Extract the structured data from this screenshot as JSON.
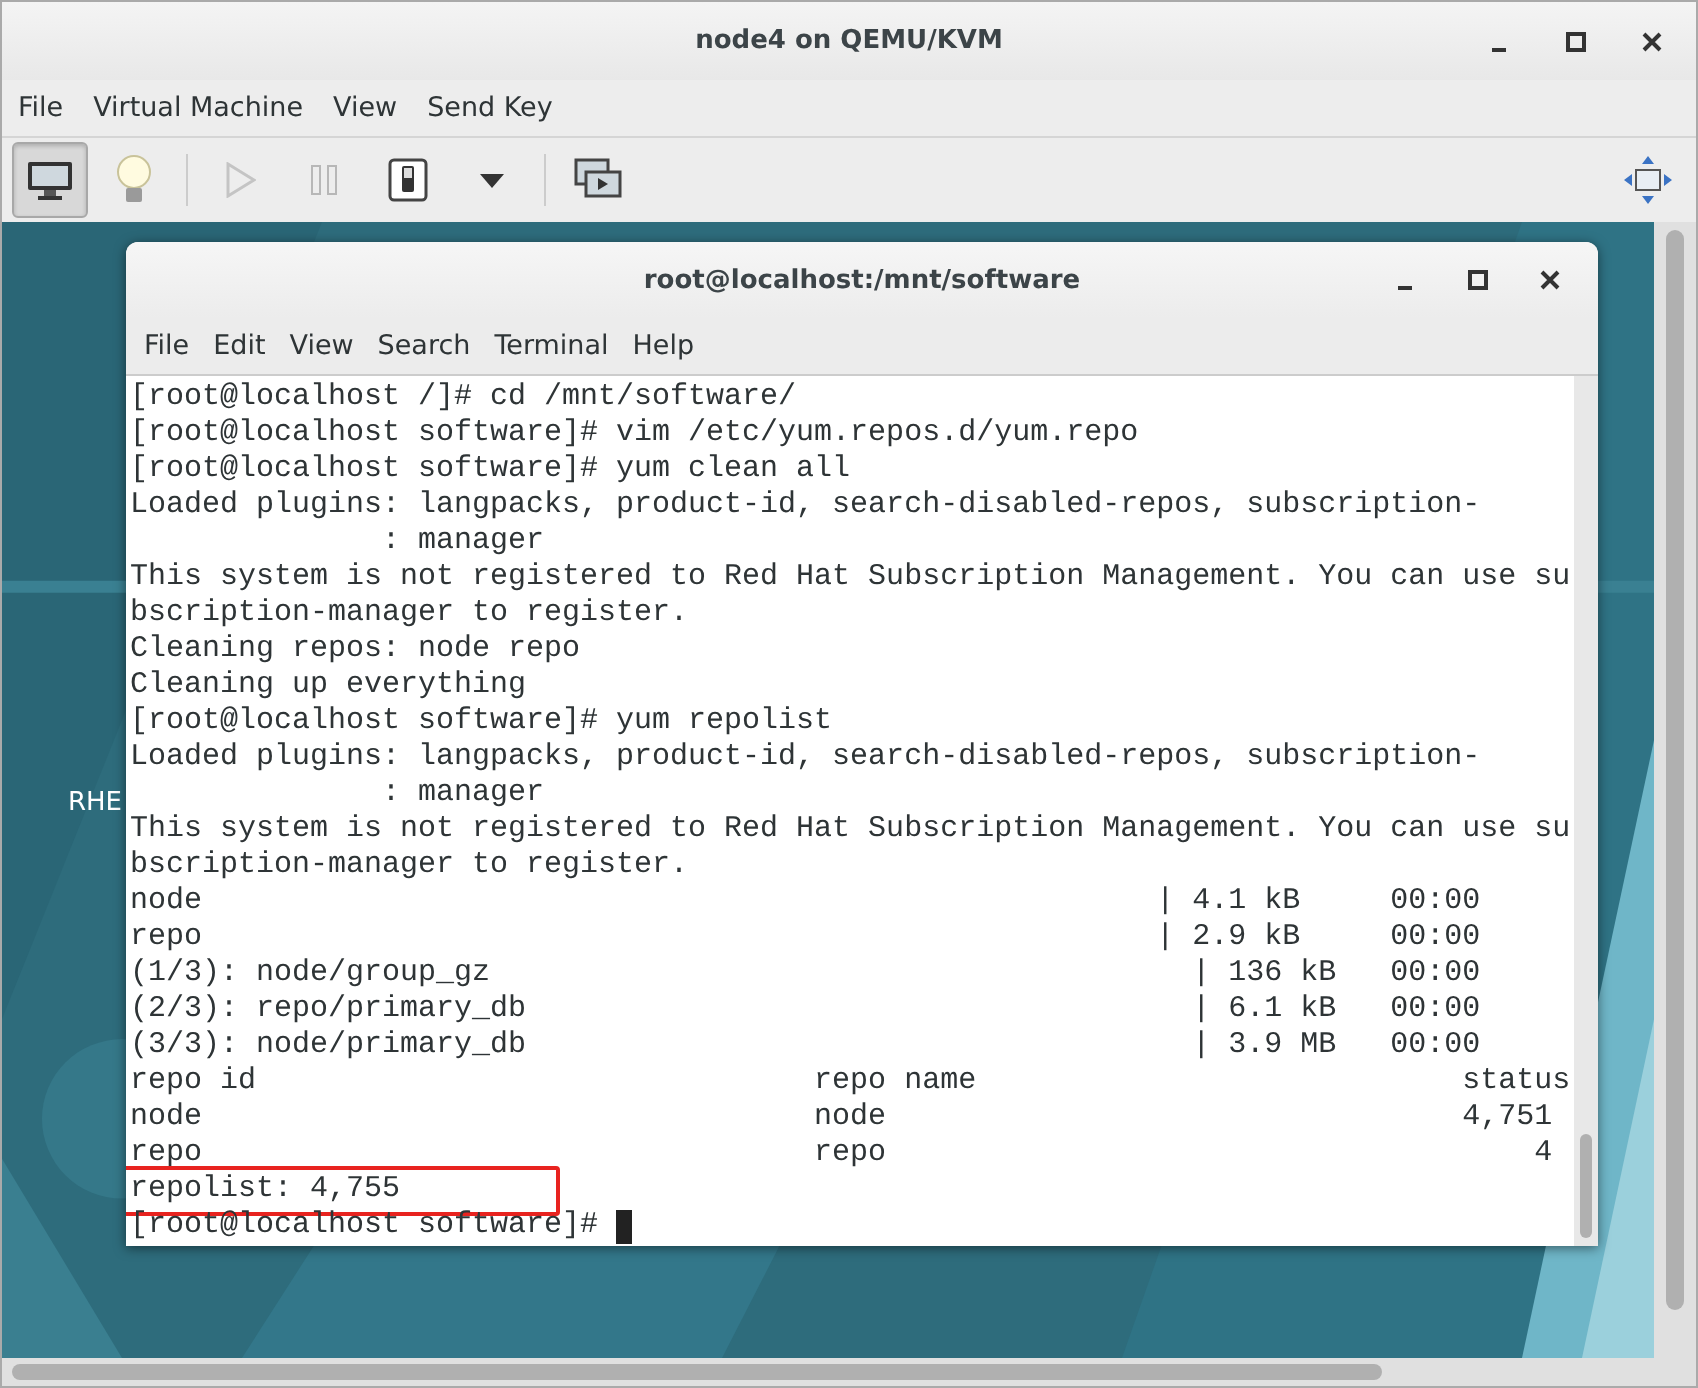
{
  "window": {
    "title": "node4 on QEMU/KVM"
  },
  "menu": [
    "File",
    "Virtual Machine",
    "View",
    "Send Key"
  ],
  "toolbar": [
    {
      "kind": "monitor",
      "selected": true,
      "disabled": false
    },
    {
      "kind": "bulb",
      "selected": false,
      "disabled": false
    },
    {
      "kind": "separator"
    },
    {
      "kind": "play",
      "selected": false,
      "disabled": true
    },
    {
      "kind": "pause",
      "selected": false,
      "disabled": true
    },
    {
      "kind": "switch",
      "selected": false,
      "disabled": false
    },
    {
      "kind": "caret",
      "selected": false,
      "disabled": false
    },
    {
      "kind": "separator"
    },
    {
      "kind": "screens",
      "selected": false,
      "disabled": false
    },
    {
      "kind": "fullscreen",
      "selected": false,
      "disabled": false
    }
  ],
  "desktop": {
    "label": "RHE"
  },
  "terminal": {
    "title": "root@localhost:/mnt/software",
    "menu": [
      "File",
      "Edit",
      "View",
      "Search",
      "Terminal",
      "Help"
    ],
    "lines": [
      {
        "text": "[root@localhost /]# cd /mnt/software/",
        "highlighted": false,
        "cursor": false
      },
      {
        "text": "[root@localhost software]# vim /etc/yum.repos.d/yum.repo",
        "highlighted": false,
        "cursor": false
      },
      {
        "text": "[root@localhost software]# yum clean all",
        "highlighted": false,
        "cursor": false
      },
      {
        "text": "Loaded plugins: langpacks, product-id, search-disabled-repos, subscription-",
        "highlighted": false,
        "cursor": false
      },
      {
        "text": "              : manager",
        "highlighted": false,
        "cursor": false
      },
      {
        "text": "This system is not registered to Red Hat Subscription Management. You can use su",
        "highlighted": false,
        "cursor": false
      },
      {
        "text": "bscription-manager to register.",
        "highlighted": false,
        "cursor": false
      },
      {
        "text": "Cleaning repos: node repo",
        "highlighted": false,
        "cursor": false
      },
      {
        "text": "Cleaning up everything",
        "highlighted": false,
        "cursor": false
      },
      {
        "text": "[root@localhost software]# yum repolist",
        "highlighted": false,
        "cursor": false
      },
      {
        "text": "Loaded plugins: langpacks, product-id, search-disabled-repos, subscription-",
        "highlighted": false,
        "cursor": false
      },
      {
        "text": "              : manager",
        "highlighted": false,
        "cursor": false
      },
      {
        "text": "This system is not registered to Red Hat Subscription Management. You can use su",
        "highlighted": false,
        "cursor": false
      },
      {
        "text": "bscription-manager to register.",
        "highlighted": false,
        "cursor": false
      },
      {
        "text": "node                                                     | 4.1 kB     00:00",
        "highlighted": false,
        "cursor": false
      },
      {
        "text": "repo                                                     | 2.9 kB     00:00",
        "highlighted": false,
        "cursor": false
      },
      {
        "text": "(1/3): node/group_gz                                       | 136 kB   00:00",
        "highlighted": false,
        "cursor": false
      },
      {
        "text": "(2/3): repo/primary_db                                     | 6.1 kB   00:00",
        "highlighted": false,
        "cursor": false
      },
      {
        "text": "(3/3): node/primary_db                                     | 3.9 MB   00:00",
        "highlighted": false,
        "cursor": false
      },
      {
        "text": "repo id                               repo name                           status",
        "highlighted": false,
        "cursor": false
      },
      {
        "text": "node                                  node                                4,751",
        "highlighted": false,
        "cursor": false
      },
      {
        "text": "repo                                  repo                                    4",
        "highlighted": false,
        "cursor": false
      },
      {
        "text": "repolist: 4,755",
        "highlighted": true,
        "cursor": false
      },
      {
        "text": "[root@localhost software]#",
        "highlighted": false,
        "cursor": true
      }
    ]
  }
}
